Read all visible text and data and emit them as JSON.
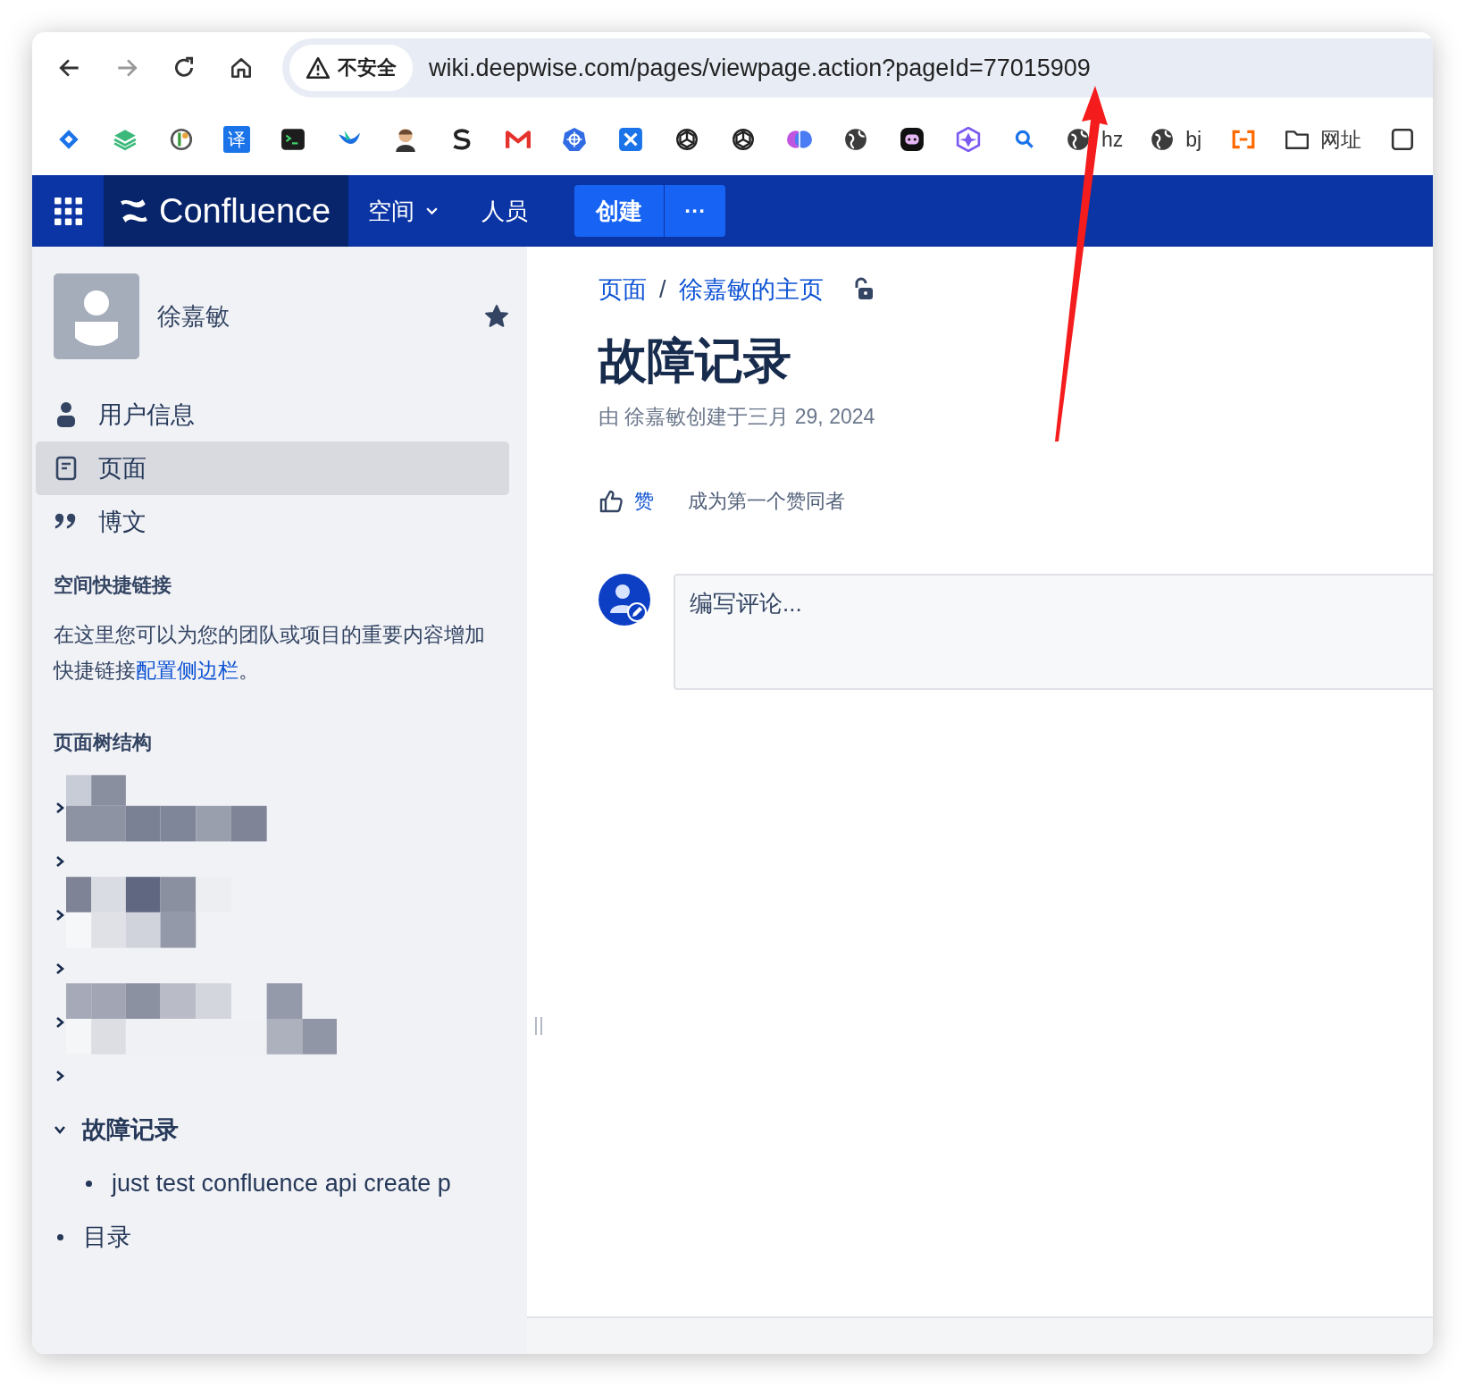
{
  "browser": {
    "security_label": "不安全",
    "url": "wiki.deepwise.com/pages/viewpage.action?pageId=77015909",
    "bookmarks": [
      {
        "kind": "badge",
        "label": "译"
      },
      {
        "kind": "link",
        "label": "hz"
      },
      {
        "kind": "link",
        "label": "bj"
      },
      {
        "kind": "folder",
        "label": "网址"
      }
    ]
  },
  "header": {
    "logo": "Confluence",
    "nav": [
      {
        "label": "空间",
        "dropdown": true
      },
      {
        "label": "人员",
        "dropdown": false
      }
    ],
    "create_button": "创建",
    "more_button": "···"
  },
  "sidebar": {
    "space_name": "徐嘉敏",
    "starred": true,
    "items": [
      {
        "label": "用户信息",
        "selected": false
      },
      {
        "label": "页面",
        "selected": true
      },
      {
        "label": "博文",
        "selected": false
      }
    ],
    "shortcuts_title": "空间快捷链接",
    "shortcuts_text": "在这里您可以为您的团队或项目的重要内容增加快捷链接",
    "shortcuts_link": "配置侧边栏",
    "shortcuts_end": "。",
    "tree_title": "页面树结构",
    "tree": [
      {
        "kind": "redacted",
        "expanded": false
      },
      {
        "kind": "redacted",
        "expanded": false
      },
      {
        "kind": "redacted",
        "expanded": false
      },
      {
        "kind": "redacted",
        "expanded": false
      },
      {
        "kind": "redacted",
        "expanded": false
      },
      {
        "kind": "redacted",
        "expanded": false
      },
      {
        "kind": "page",
        "label": "故障记录",
        "expanded": true,
        "children": [
          {
            "kind": "page",
            "label": "just test confluence api create p"
          }
        ]
      },
      {
        "kind": "page",
        "label": "目录"
      }
    ]
  },
  "content": {
    "breadcrumbs": [
      "页面",
      "徐嘉敏的主页"
    ],
    "breadcrumb_separator": "/",
    "title": "故障记录",
    "byline": "由 徐嘉敏创建于三月 29, 2024",
    "like_button": "赞",
    "like_prompt": "成为第一个赞同者",
    "comment": {
      "placeholder": "编写评论..."
    }
  }
}
